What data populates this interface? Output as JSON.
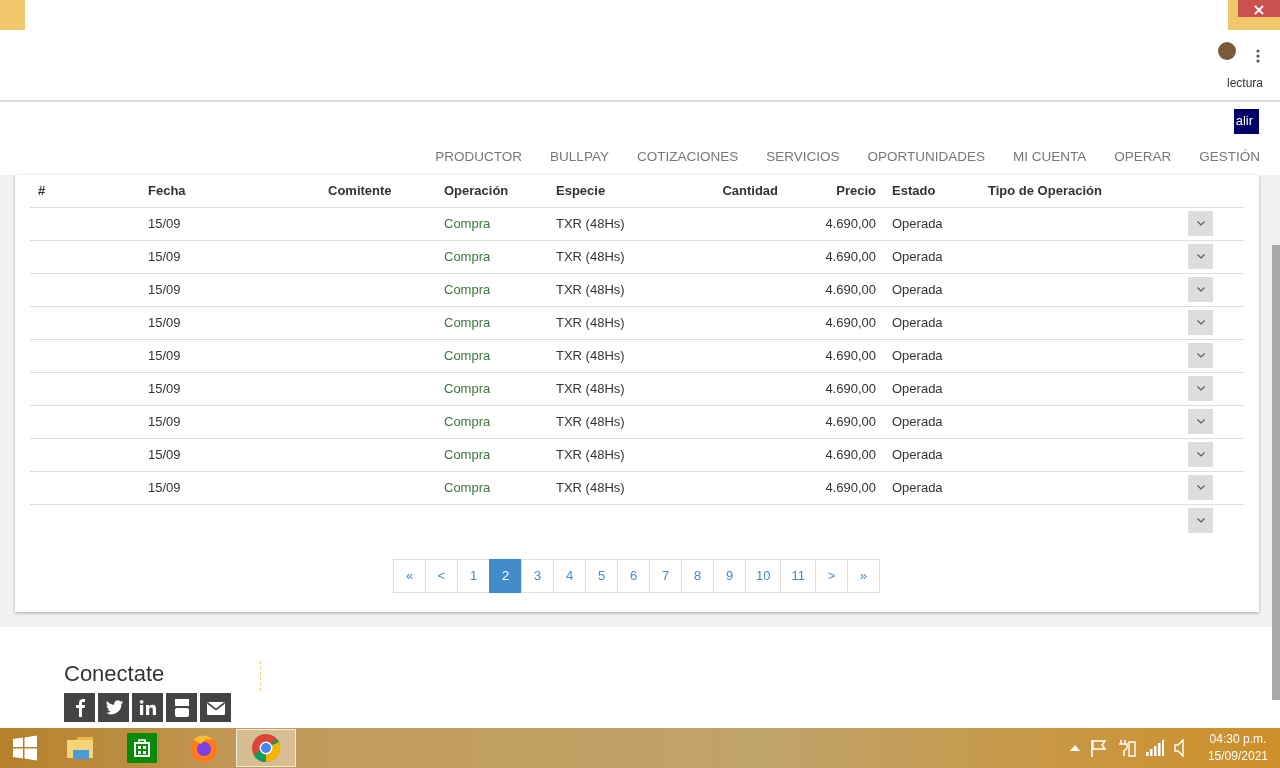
{
  "browser": {
    "reading_mode_label": "lectura",
    "logout_button": "alir"
  },
  "nav": [
    {
      "label": "PRODUCTOR"
    },
    {
      "label": "BULLPAY"
    },
    {
      "label": "COTIZACIONES"
    },
    {
      "label": "SERVICIOS"
    },
    {
      "label": "OPORTUNIDADES"
    },
    {
      "label": "MI CUENTA"
    },
    {
      "label": "OPERAR"
    },
    {
      "label": "GESTIÓN"
    }
  ],
  "table": {
    "columns": [
      "#",
      "Fecha",
      "Comitente",
      "Operación",
      "Especie",
      "Cantidad",
      "Precio",
      "Estado",
      "Tipo de Operación"
    ],
    "rows": [
      {
        "fecha": "15/09",
        "operacion": "Compra",
        "especie": "TXR (48Hs)",
        "precio": "4.690,00",
        "estado": "Operada"
      },
      {
        "fecha": "15/09",
        "operacion": "Compra",
        "especie": "TXR (48Hs)",
        "precio": "4.690,00",
        "estado": "Operada"
      },
      {
        "fecha": "15/09",
        "operacion": "Compra",
        "especie": "TXR (48Hs)",
        "precio": "4.690,00",
        "estado": "Operada"
      },
      {
        "fecha": "15/09",
        "operacion": "Compra",
        "especie": "TXR (48Hs)",
        "precio": "4.690,00",
        "estado": "Operada"
      },
      {
        "fecha": "15/09",
        "operacion": "Compra",
        "especie": "TXR (48Hs)",
        "precio": "4.690,00",
        "estado": "Operada"
      },
      {
        "fecha": "15/09",
        "operacion": "Compra",
        "especie": "TXR (48Hs)",
        "precio": "4.690,00",
        "estado": "Operada"
      },
      {
        "fecha": "15/09",
        "operacion": "Compra",
        "especie": "TXR (48Hs)",
        "precio": "4.690,00",
        "estado": "Operada"
      },
      {
        "fecha": "15/09",
        "operacion": "Compra",
        "especie": "TXR (48Hs)",
        "precio": "4.690,00",
        "estado": "Operada"
      },
      {
        "fecha": "15/09",
        "operacion": "Compra",
        "especie": "TXR (48Hs)",
        "precio": "4.690,00",
        "estado": "Operada"
      }
    ],
    "trailing_toggle": true
  },
  "pagination": [
    {
      "label": "«",
      "selected": false
    },
    {
      "label": "<",
      "selected": false
    },
    {
      "label": "1",
      "selected": false
    },
    {
      "label": "2",
      "selected": true
    },
    {
      "label": "3",
      "selected": false
    },
    {
      "label": "4",
      "selected": false
    },
    {
      "label": "5",
      "selected": false
    },
    {
      "label": "6",
      "selected": false
    },
    {
      "label": "7",
      "selected": false
    },
    {
      "label": "8",
      "selected": false
    },
    {
      "label": "9",
      "selected": false
    },
    {
      "label": "10",
      "selected": false
    },
    {
      "label": "11",
      "selected": false
    },
    {
      "label": ">",
      "selected": false
    },
    {
      "label": "»",
      "selected": false
    }
  ],
  "footer": {
    "heading": "Conectate",
    "social": [
      {
        "kind": "facebook"
      },
      {
        "kind": "twitter"
      },
      {
        "kind": "linkedin"
      },
      {
        "kind": "youtube"
      },
      {
        "kind": "email"
      }
    ]
  },
  "taskbar": {
    "apps": [
      {
        "kind": "explorer",
        "selected": false
      },
      {
        "kind": "store",
        "selected": false
      },
      {
        "kind": "firefox",
        "selected": false
      },
      {
        "kind": "chrome",
        "selected": true
      }
    ],
    "tray": [
      {
        "kind": "arrow"
      },
      {
        "kind": "flag"
      },
      {
        "kind": "power"
      },
      {
        "kind": "signal"
      },
      {
        "kind": "volume"
      }
    ],
    "time": "04:30 p.m.",
    "date": "15/09/2021"
  }
}
